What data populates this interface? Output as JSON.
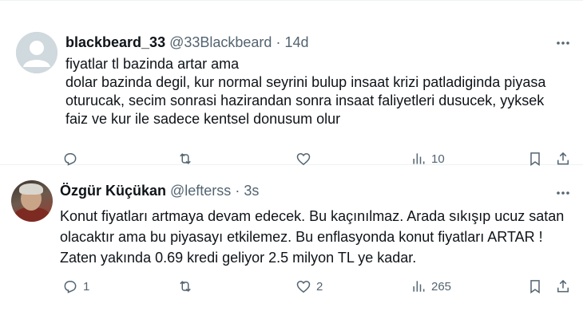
{
  "tweets": [
    {
      "display_name": "blackbeard_33",
      "handle": "@33Blackbeard",
      "separator": "·",
      "time": "14d",
      "text": "fiyatlar tl bazinda artar ama\ndolar bazinda degil, kur normal seyrini bulup insaat krizi patladiginda piyasa oturucak, secim sonrasi hazirandan sonra insaat faliyetleri dusucek, yyksek faiz ve kur ile sadece kentsel donusum olur",
      "actions": {
        "reply_count": "",
        "retweet_count": "",
        "like_count": "",
        "views_count": "10"
      }
    },
    {
      "display_name": "Özgür Küçükan",
      "handle": "@lefterss",
      "separator": "·",
      "time": "3s",
      "text": "Konut fiyatları artmaya devam edecek. Bu kaçınılmaz.  Arada sıkışıp ucuz satan olacaktır ama bu piyasayı etkilemez. Bu enflasyonda konut fiyatları ARTAR ! Zaten yakında 0.69 kredi geliyor 2.5 milyon TL ye kadar.",
      "actions": {
        "reply_count": "1",
        "retweet_count": "",
        "like_count": "2",
        "views_count": "265"
      }
    }
  ],
  "icons": {
    "reply": "reply-icon",
    "retweet": "retweet-icon",
    "like": "heart-icon",
    "views": "views-icon",
    "bookmark": "bookmark-icon",
    "share": "share-icon",
    "more": "more-icon"
  },
  "colors": {
    "text": "#0f1419",
    "secondary": "#536471",
    "divider": "#eff3f4"
  }
}
